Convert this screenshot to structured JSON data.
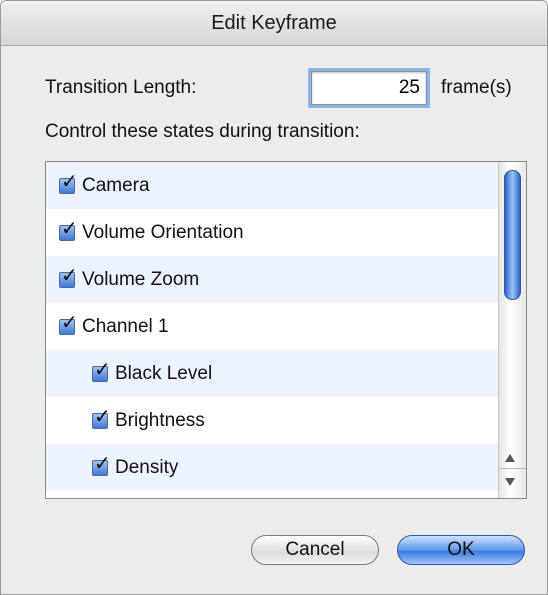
{
  "window": {
    "title": "Edit Keyframe"
  },
  "transition": {
    "label": "Transition Length:",
    "value": "25",
    "unit": "frame(s)"
  },
  "states": {
    "heading": "Control these states during transition:",
    "items": [
      {
        "label": "Camera",
        "checked": true,
        "indent": 0
      },
      {
        "label": "Volume Orientation",
        "checked": true,
        "indent": 0
      },
      {
        "label": "Volume Zoom",
        "checked": true,
        "indent": 0
      },
      {
        "label": "Channel 1",
        "checked": true,
        "indent": 0
      },
      {
        "label": "Black Level",
        "checked": true,
        "indent": 1
      },
      {
        "label": "Brightness",
        "checked": true,
        "indent": 1
      },
      {
        "label": "Density",
        "checked": true,
        "indent": 1
      }
    ],
    "check_glyph": "✓"
  },
  "buttons": {
    "cancel": "Cancel",
    "ok": "OK"
  },
  "colors": {
    "accent": "#3a7be0",
    "alt_row": "#edf3fe"
  },
  "icons": {
    "scroll_up": "scroll-up-arrow-icon",
    "scroll_down": "scroll-down-arrow-icon"
  }
}
